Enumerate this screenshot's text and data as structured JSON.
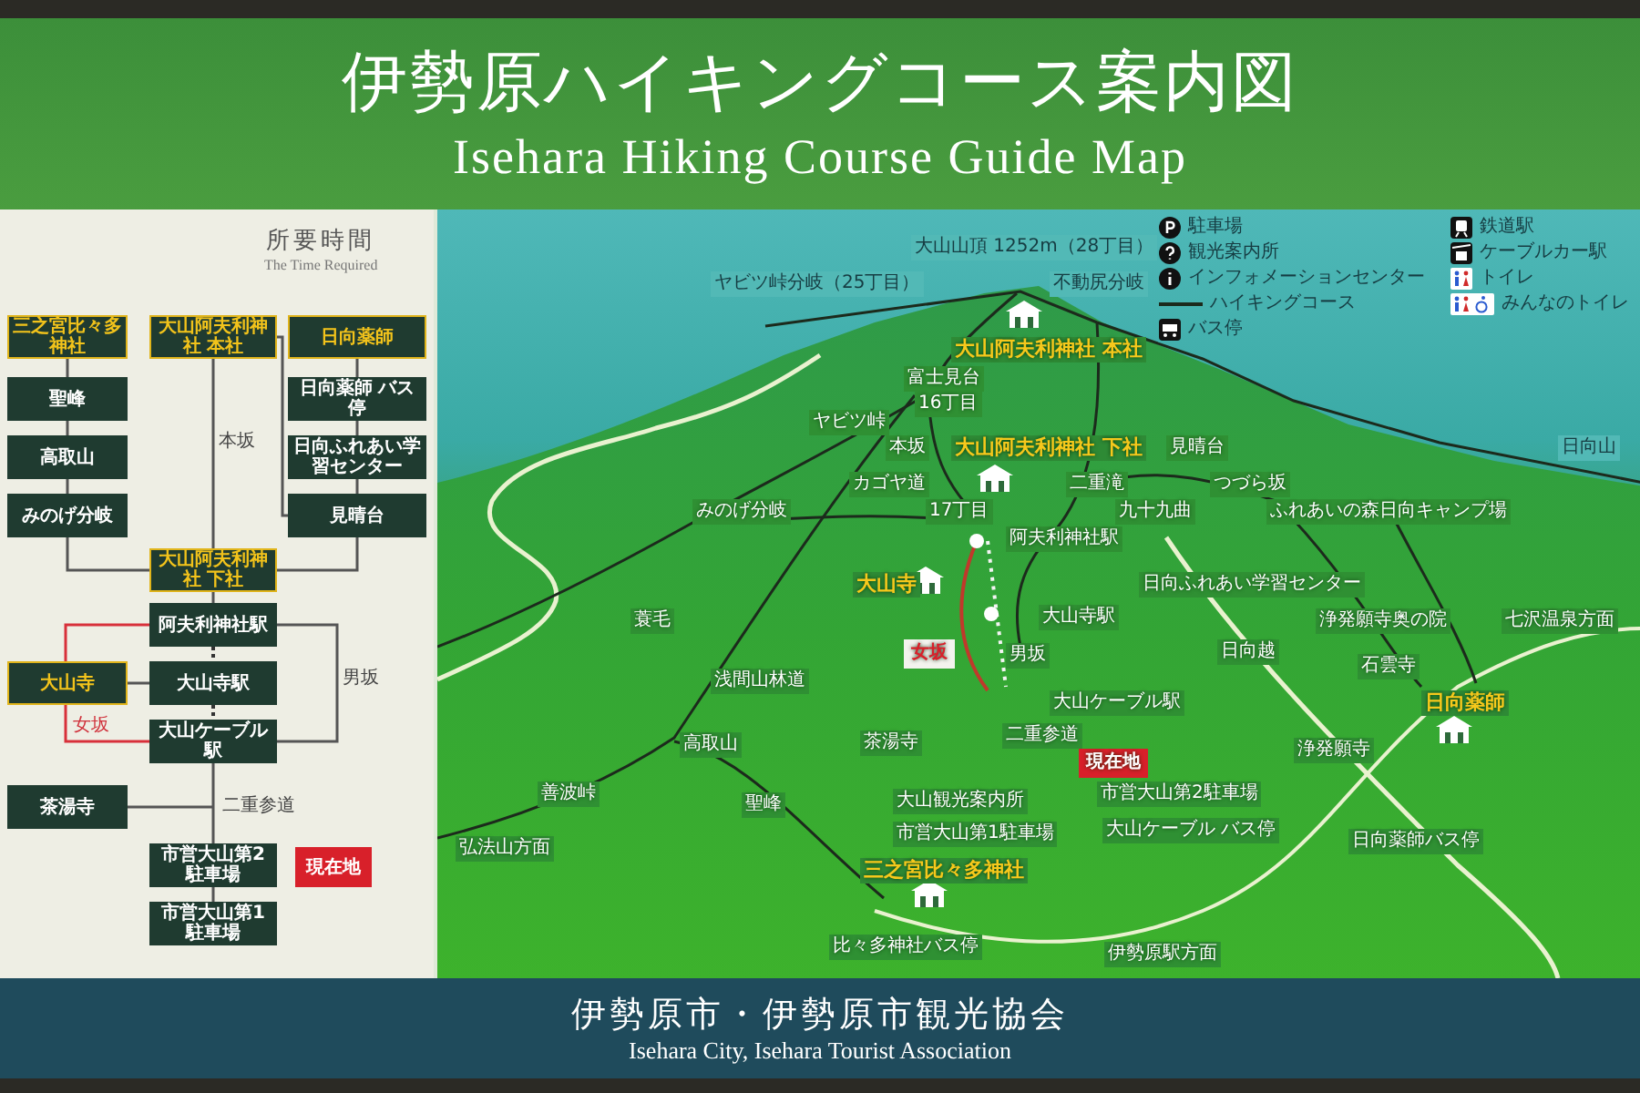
{
  "header": {
    "title_ja": "伊勢原ハイキングコース案内図",
    "title_en": "Isehara Hiking Course Guide Map"
  },
  "time_panel": {
    "title_ja": "所要時間",
    "title_en": "The Time Required",
    "current_location": "現在地",
    "nodes": [
      {
        "label": "三之宮比々多神社",
        "featured": true
      },
      {
        "label": "大山阿夫利神社 本社",
        "featured": true
      },
      {
        "label": "日向薬師",
        "featured": true
      },
      {
        "label": "聖峰",
        "featured": false
      },
      {
        "label": "日向薬師 バス停",
        "featured": false
      },
      {
        "label": "高取山",
        "featured": false
      },
      {
        "label": "日向ふれあい学習センター",
        "featured": false
      },
      {
        "label": "みのげ分岐",
        "featured": false
      },
      {
        "label": "見晴台",
        "featured": false
      },
      {
        "label": "大山阿夫利神社 下社",
        "featured": true
      },
      {
        "label": "阿夫利神社駅",
        "featured": false
      },
      {
        "label": "大山寺",
        "featured": true
      },
      {
        "label": "大山寺駅",
        "featured": false
      },
      {
        "label": "大山ケーブル駅",
        "featured": false
      },
      {
        "label": "茶湯寺",
        "featured": false
      },
      {
        "label": "市営大山第2駐車場",
        "featured": false
      },
      {
        "label": "市営大山第1駐車場",
        "featured": false
      }
    ],
    "trail_labels": [
      {
        "label": "本坂",
        "kind": "plain"
      },
      {
        "label": "男坂",
        "kind": "plain"
      },
      {
        "label": "女坂",
        "kind": "accent"
      },
      {
        "label": "二重参道",
        "kind": "plain"
      }
    ]
  },
  "map": {
    "legend": [
      {
        "label": "駐車場",
        "kind": "parking"
      },
      {
        "label": "観光案内所",
        "kind": "info-desk"
      },
      {
        "label": "インフォメーションセンター",
        "kind": "info-center"
      },
      {
        "label": "ハイキングコース",
        "kind": "trail"
      },
      {
        "label": "バス停",
        "kind": "bus"
      },
      {
        "label": "鉄道駅",
        "kind": "train"
      },
      {
        "label": "ケーブルカー駅",
        "kind": "cable"
      },
      {
        "label": "トイレ",
        "kind": "toilet"
      },
      {
        "label": "みんなのトイレ",
        "kind": "accessible-toilet"
      }
    ],
    "places": [
      {
        "label": "大山山頂 1252m（28丁目）",
        "kind": "sky"
      },
      {
        "label": "ヤビツ峠分岐（25丁目）",
        "kind": "sky"
      },
      {
        "label": "不動尻分岐",
        "kind": "sky"
      },
      {
        "label": "大山阿夫利神社 本社",
        "kind": "major"
      },
      {
        "label": "富士見台",
        "kind": "place"
      },
      {
        "label": "16丁目",
        "kind": "place"
      },
      {
        "label": "ヤビツ峠",
        "kind": "place"
      },
      {
        "label": "本坂",
        "kind": "place"
      },
      {
        "label": "大山阿夫利神社 下社",
        "kind": "major"
      },
      {
        "label": "見晴台",
        "kind": "place"
      },
      {
        "label": "日向山",
        "kind": "sky"
      },
      {
        "label": "カゴヤ道",
        "kind": "place"
      },
      {
        "label": "二重滝",
        "kind": "place"
      },
      {
        "label": "つづら坂",
        "kind": "place"
      },
      {
        "label": "みのげ分岐",
        "kind": "place"
      },
      {
        "label": "17丁目",
        "kind": "place"
      },
      {
        "label": "九十九曲",
        "kind": "place"
      },
      {
        "label": "ふれあいの森日向キャンプ場",
        "kind": "place"
      },
      {
        "label": "阿夫利神社駅",
        "kind": "place"
      },
      {
        "label": "大山寺",
        "kind": "major"
      },
      {
        "label": "日向ふれあい学習センター",
        "kind": "place"
      },
      {
        "label": "蓑毛",
        "kind": "place"
      },
      {
        "label": "大山寺駅",
        "kind": "place"
      },
      {
        "label": "浄発願寺奥の院",
        "kind": "place"
      },
      {
        "label": "七沢温泉方面",
        "kind": "place"
      },
      {
        "label": "女坂",
        "kind": "accent"
      },
      {
        "label": "男坂",
        "kind": "place"
      },
      {
        "label": "日向越",
        "kind": "place"
      },
      {
        "label": "石雲寺",
        "kind": "place"
      },
      {
        "label": "浅間山林道",
        "kind": "place"
      },
      {
        "label": "大山ケーブル駅",
        "kind": "place"
      },
      {
        "label": "日向薬師",
        "kind": "major"
      },
      {
        "label": "高取山",
        "kind": "place"
      },
      {
        "label": "茶湯寺",
        "kind": "place"
      },
      {
        "label": "二重参道",
        "kind": "place"
      },
      {
        "label": "現在地",
        "kind": "current"
      },
      {
        "label": "浄発願寺",
        "kind": "place"
      },
      {
        "label": "善波峠",
        "kind": "place"
      },
      {
        "label": "聖峰",
        "kind": "place"
      },
      {
        "label": "大山観光案内所",
        "kind": "place"
      },
      {
        "label": "市営大山第2駐車場",
        "kind": "place"
      },
      {
        "label": "弘法山方面",
        "kind": "place"
      },
      {
        "label": "市営大山第1駐車場",
        "kind": "place"
      },
      {
        "label": "大山ケーブル バス停",
        "kind": "place"
      },
      {
        "label": "日向薬師バス停",
        "kind": "place"
      },
      {
        "label": "三之宮比々多神社",
        "kind": "major"
      },
      {
        "label": "比々多神社バス停",
        "kind": "place"
      },
      {
        "label": "伊勢原駅方面",
        "kind": "place"
      }
    ]
  },
  "footer": {
    "org_ja": "伊勢原市・伊勢原市観光協会",
    "org_en": "Isehara City, Isehara Tourist Association"
  }
}
